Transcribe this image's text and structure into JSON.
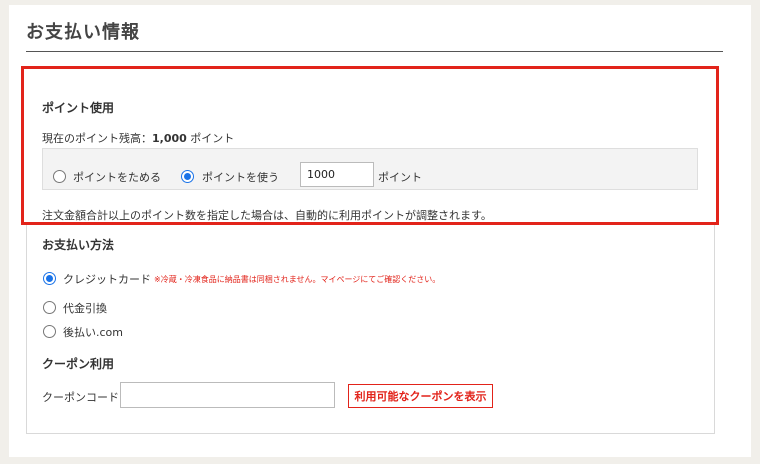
{
  "page": {
    "title": "お支払い情報"
  },
  "points": {
    "heading": "ポイント使用",
    "balance_label": "現在のポイント残高：",
    "balance_value": "1,000",
    "balance_unit": "ポイント",
    "option_save": "ポイントをためる",
    "option_use": "ポイントを使う",
    "selected": "use",
    "input_value": "1000",
    "input_unit": "ポイント",
    "note": "注文金額合計以上のポイント数を指定した場合は、自動的に利用ポイントが調整されます。"
  },
  "payment": {
    "heading": "お支払い方法",
    "methods": [
      {
        "label": "クレジットカード",
        "selected": true
      },
      {
        "label": "代金引換",
        "selected": false
      },
      {
        "label": "後払い.com",
        "selected": false
      }
    ],
    "credit_note": "※冷蔵・冷凍食品に納品書は同梱されません。マイページにてご確認ください。"
  },
  "coupon": {
    "heading": "クーポン利用",
    "code_label": "クーポンコード：",
    "code_value": "",
    "button_label": "利用可能なクーポンを表示"
  },
  "colors": {
    "accent_red": "#e2231a",
    "radio_blue": "#1a73e8",
    "background": "#f1efea"
  }
}
